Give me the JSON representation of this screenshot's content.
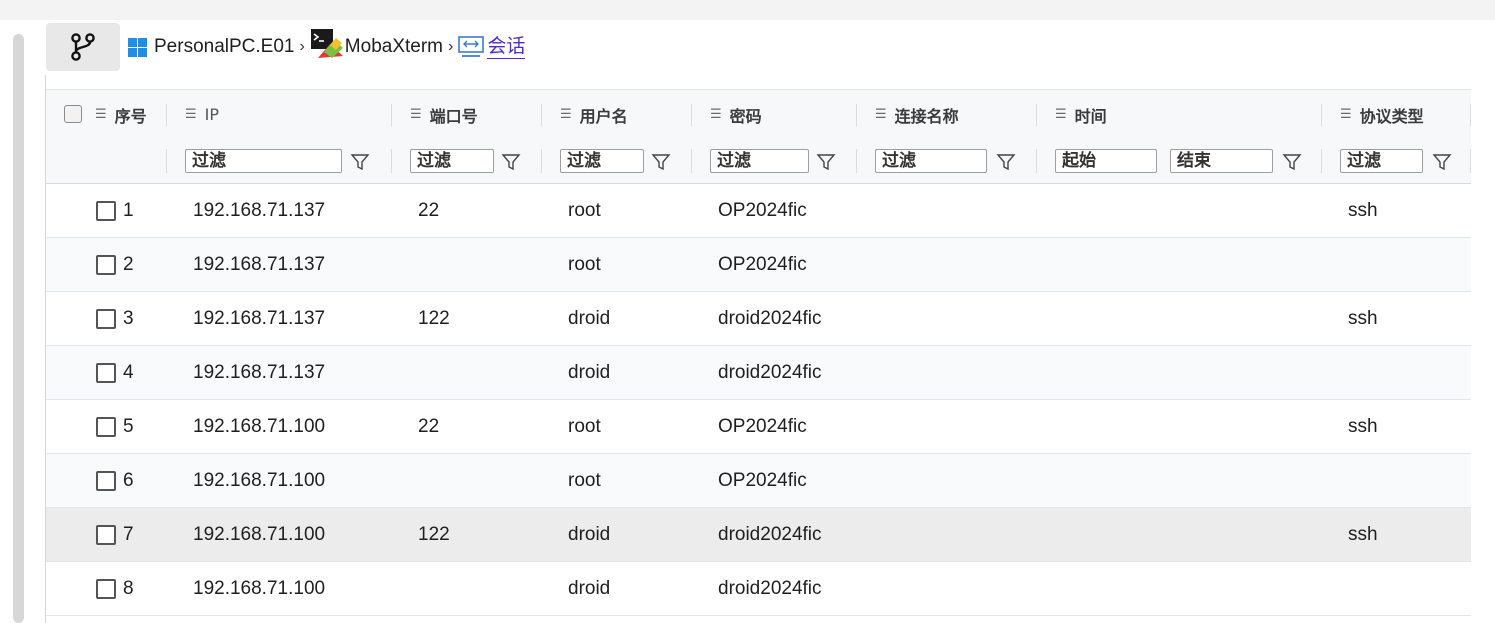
{
  "breadcrumb": {
    "items": [
      {
        "label": "PersonalPC.E01",
        "icon": "windows-icon"
      },
      {
        "label": "MobaXterm",
        "icon": "mobaxterm-icon"
      },
      {
        "label": "会话",
        "icon": "session-icon",
        "link": true
      }
    ],
    "separator": "›"
  },
  "table": {
    "headers": {
      "seq": "序号",
      "ip": "IP",
      "port": "端口号",
      "user": "用户名",
      "password": "密码",
      "conn_name": "连接名称",
      "time": "时间",
      "protocol": "协议类型"
    },
    "filters": {
      "ip": "过滤",
      "port": "过滤",
      "user": "过滤",
      "password": "过滤",
      "conn_name": "过滤",
      "time_start": "起始",
      "time_end": "结束",
      "protocol": "过滤"
    },
    "rows": [
      {
        "seq": "1",
        "ip": "192.168.71.137",
        "port": "22",
        "user": "root",
        "password": "OP2024fic",
        "conn_name": "",
        "time": "",
        "protocol": "ssh"
      },
      {
        "seq": "2",
        "ip": "192.168.71.137",
        "port": "",
        "user": "root",
        "password": "OP2024fic",
        "conn_name": "",
        "time": "",
        "protocol": ""
      },
      {
        "seq": "3",
        "ip": "192.168.71.137",
        "port": "122",
        "user": "droid",
        "password": "droid2024fic",
        "conn_name": "",
        "time": "",
        "protocol": "ssh"
      },
      {
        "seq": "4",
        "ip": "192.168.71.137",
        "port": "",
        "user": "droid",
        "password": "droid2024fic",
        "conn_name": "",
        "time": "",
        "protocol": ""
      },
      {
        "seq": "5",
        "ip": "192.168.71.100",
        "port": "22",
        "user": "root",
        "password": "OP2024fic",
        "conn_name": "",
        "time": "",
        "protocol": "ssh"
      },
      {
        "seq": "6",
        "ip": "192.168.71.100",
        "port": "",
        "user": "root",
        "password": "OP2024fic",
        "conn_name": "",
        "time": "",
        "protocol": ""
      },
      {
        "seq": "7",
        "ip": "192.168.71.100",
        "port": "122",
        "user": "droid",
        "password": "droid2024fic",
        "conn_name": "",
        "time": "",
        "protocol": "ssh"
      },
      {
        "seq": "8",
        "ip": "192.168.71.100",
        "port": "",
        "user": "droid",
        "password": "droid2024fic",
        "conn_name": "",
        "time": "",
        "protocol": ""
      }
    ],
    "selected_row": 6
  },
  "colors": {
    "link": "#4a2bd4",
    "header_bg": "#f7f8fa",
    "selected_row": "#ececec",
    "windows_blue": "#1e8fe6"
  }
}
